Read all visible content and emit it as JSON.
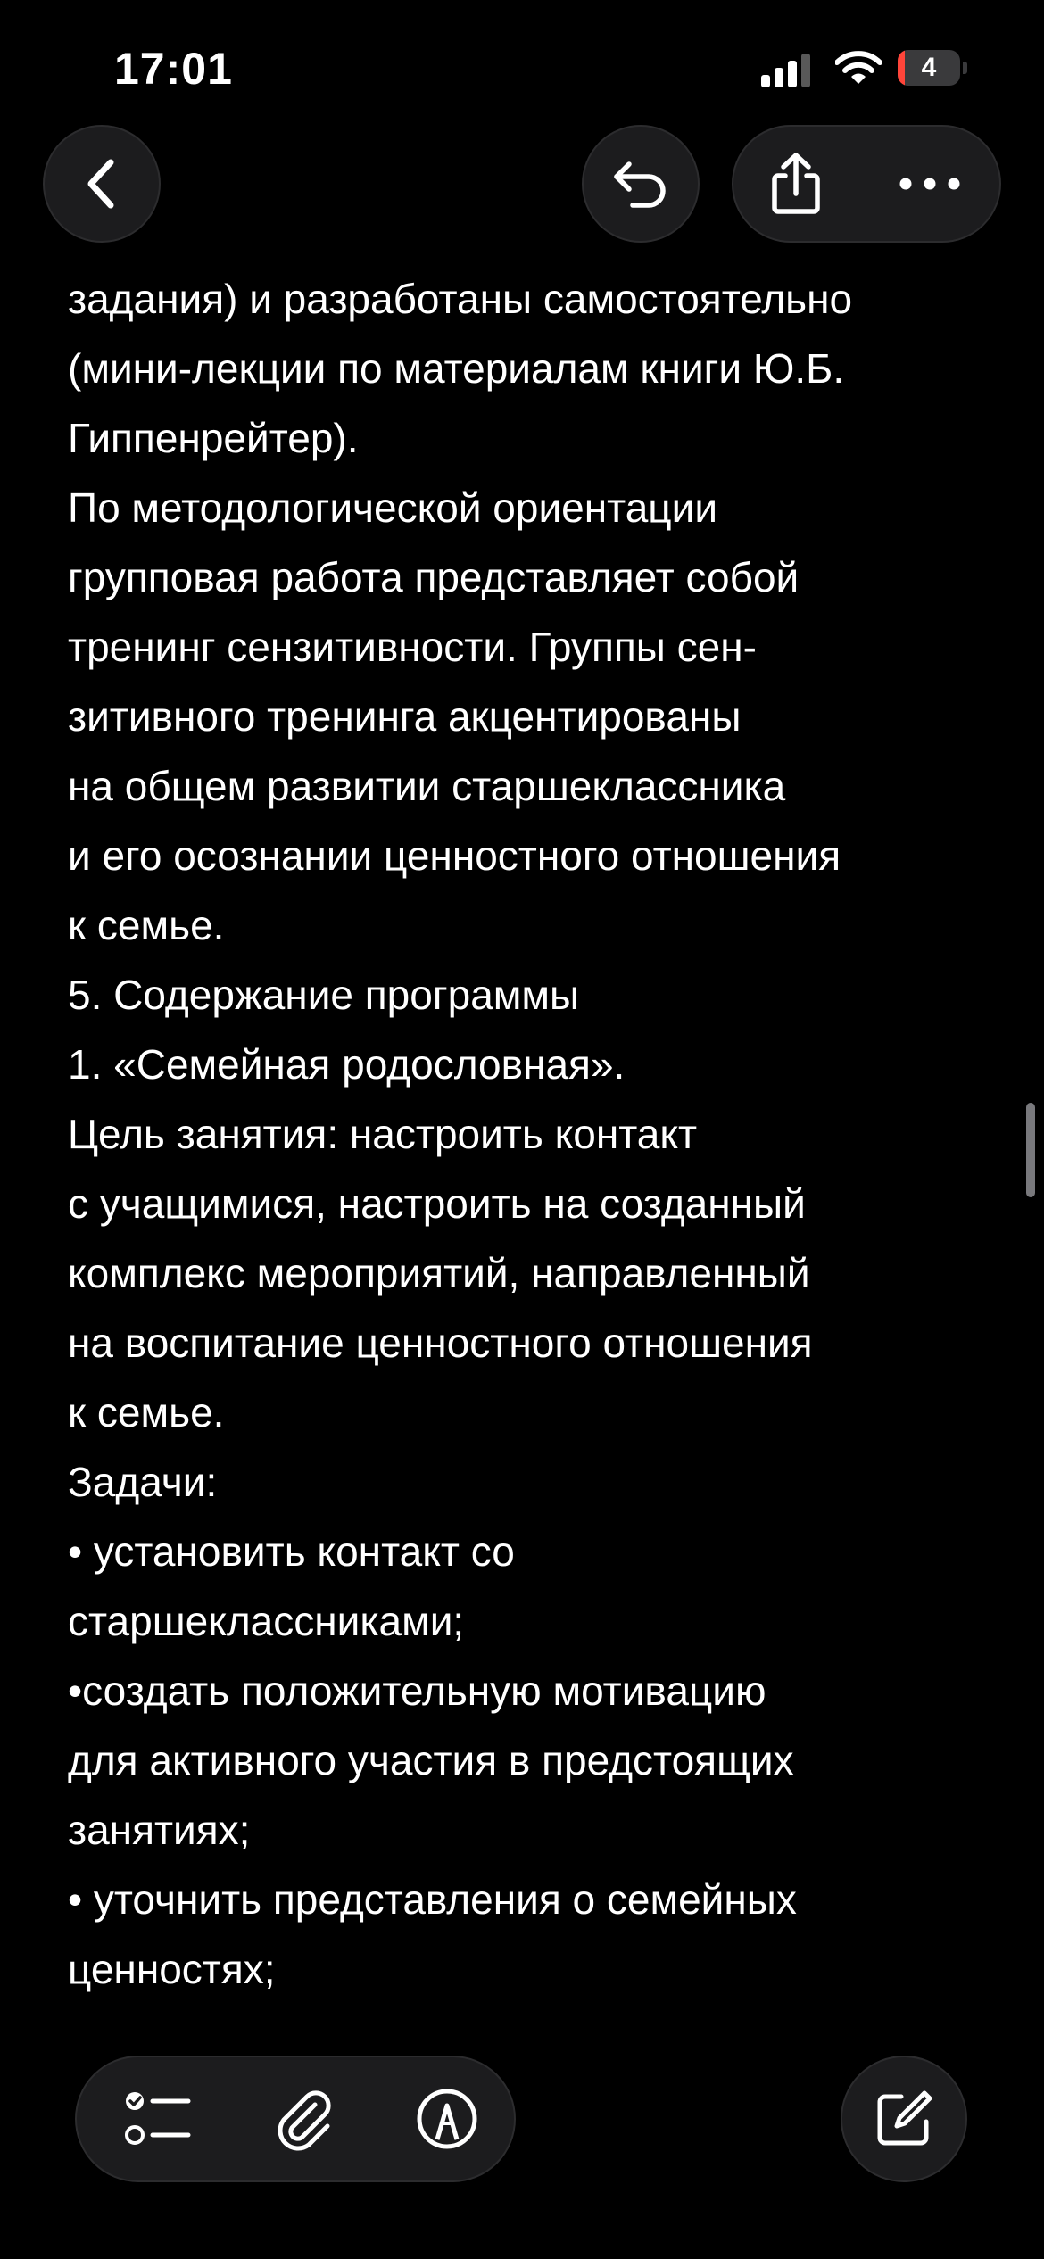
{
  "status_bar": {
    "time": "17:01",
    "battery_level": "4",
    "battery_percent": 4,
    "battery_color": "#ff453a",
    "icons": [
      "cellular-signal-icon",
      "wifi-icon",
      "battery-icon"
    ]
  },
  "nav": {
    "buttons": [
      "back-icon",
      "undo-icon",
      "share-icon",
      "more-icon"
    ]
  },
  "note": {
    "lines": [
      "задания) и разработаны самостоятельно",
      "(мини-лекции по материалам книги Ю.Б.",
      "Гиппенрейтер).",
      "По методологической ориентации",
      "групповая работа представляет собой",
      "тренинг сензитивности. Группы сен-",
      "зитивного тренинга акцентированы",
      "на общем развитии старшеклассника",
      "и его осознании ценностного отношения",
      "к семье.",
      "5. Содержание программы",
      "1. «Семейная родословная».",
      "Цель занятия: настроить контакт",
      "с учащимися, настроить на созданный",
      "комплекс мероприятий, направленный",
      "на воспитание ценностного отношения",
      "к семье.",
      "Задачи:",
      "• установить контакт со",
      "старшеклассниками;",
      "•создать положительную мотивацию",
      "для активного участия в предстоящих",
      "занятиях;",
      "• уточнить представления о семейных",
      "ценностях;"
    ]
  },
  "toolbar": {
    "buttons": [
      "checklist-icon",
      "paperclip-icon",
      "markup-pen-icon",
      "compose-icon"
    ]
  },
  "colors": {
    "background": "#000000",
    "text": "#ffffff",
    "button_fill": "#1c1c1e",
    "button_border": "#2c2c2e"
  }
}
